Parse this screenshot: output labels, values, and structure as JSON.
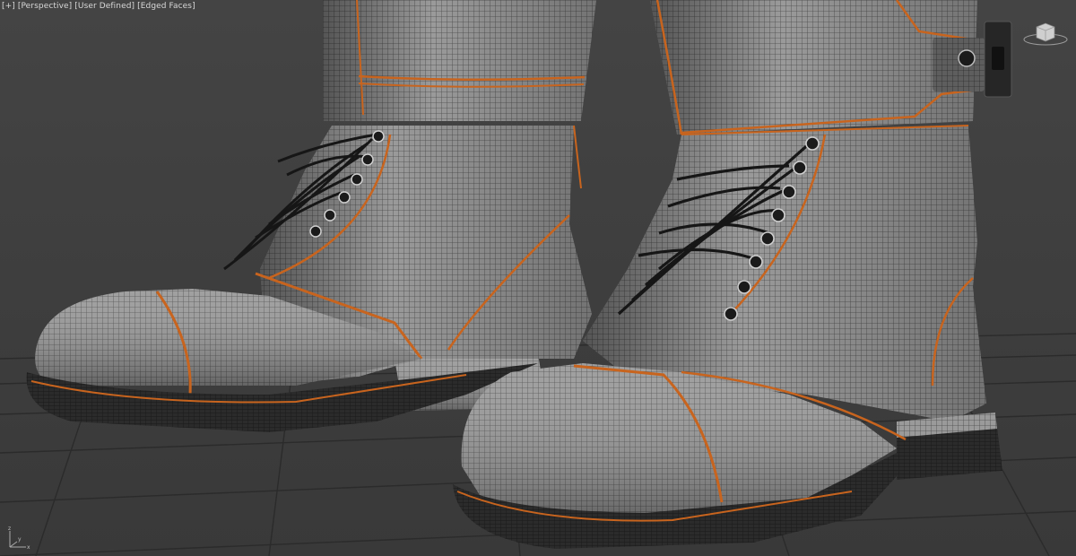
{
  "viewport": {
    "labels": {
      "plus": "[+]",
      "view": "[Perspective]",
      "camera": "[User Defined]",
      "shading": "[Edged Faces]"
    },
    "background_color": "#3d3d3d",
    "grid_color": "#2a2a2a",
    "mesh_color": "#8f8f8f",
    "seam_color": "#c8641e",
    "lace_color": "#1a1a1a"
  },
  "viewcube": {
    "icon": "viewcube-icon"
  },
  "axis_tripod": {
    "icon": "axis-tripod-icon",
    "x": "x",
    "y": "y",
    "z": "z"
  }
}
